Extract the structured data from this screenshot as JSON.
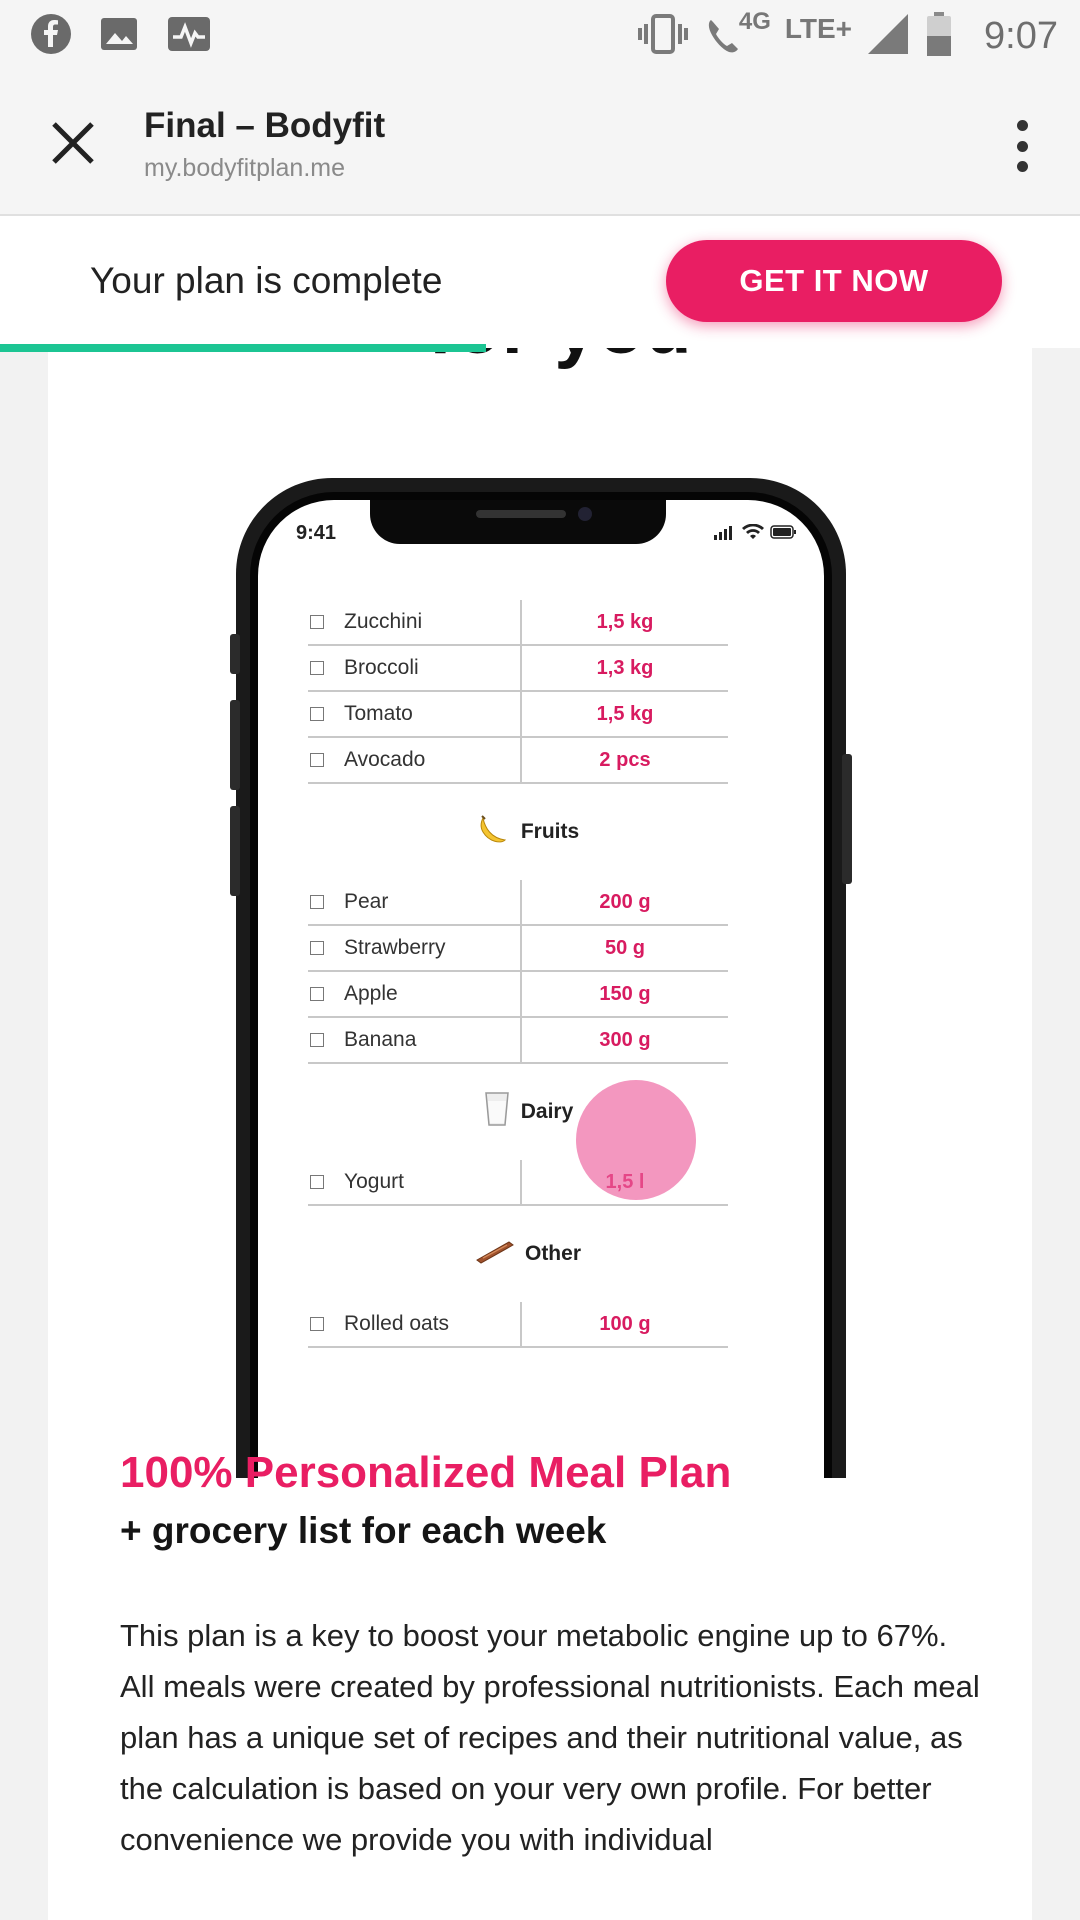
{
  "status_bar": {
    "time": "9:07",
    "network": "4G",
    "network_type": "LTE+",
    "left_icons": [
      "facebook-icon",
      "gallery-icon",
      "activity-icon"
    ],
    "right_icons": [
      "vibrate-icon",
      "wifi-call-icon",
      "signal-icon",
      "battery-icon"
    ]
  },
  "browser": {
    "page_title": "Final – Bodyfit",
    "url": "my.bodyfitplan.me"
  },
  "plan_bar": {
    "message": "Your plan is complete",
    "cta_label": "GET IT NOW",
    "progress_fraction": 0.45,
    "accent_color": "#e91e63",
    "progress_color": "#1cc593"
  },
  "page": {
    "cut_heading": "for you",
    "phone": {
      "time": "9:41",
      "groups": [
        {
          "section": "",
          "items": [
            {
              "name": "Zucchini",
              "qty": "1,5 kg"
            },
            {
              "name": "Broccoli",
              "qty": "1,3 kg"
            },
            {
              "name": "Tomato",
              "qty": "1,5 kg"
            },
            {
              "name": "Avocado",
              "qty": "2 pcs"
            }
          ]
        },
        {
          "section": "Fruits",
          "icon": "banana-icon",
          "items": [
            {
              "name": "Pear",
              "qty": "200 g"
            },
            {
              "name": "Strawberry",
              "qty": "50 g"
            },
            {
              "name": "Apple",
              "qty": "150 g"
            },
            {
              "name": "Banana",
              "qty": "300 g"
            }
          ]
        },
        {
          "section": "Dairy",
          "icon": "glass-icon",
          "items": [
            {
              "name": "Yogurt",
              "qty": "1,5 l"
            }
          ]
        },
        {
          "section": "Other",
          "icon": "cinnamon-icon",
          "items": [
            {
              "name": "Rolled oats",
              "qty": "100 g"
            }
          ]
        }
      ]
    },
    "headline": "100% Personalized Meal Plan",
    "subheadline": "+ grocery list for each week",
    "body": "This plan is a key to boost your metabolic engine up to 67%. All meals were created by professional nutritionists. Each meal plan has a unique set of recipes and their nutritional value, as the calculation is based on your very own profile. For better convenience we provide you with individual"
  }
}
